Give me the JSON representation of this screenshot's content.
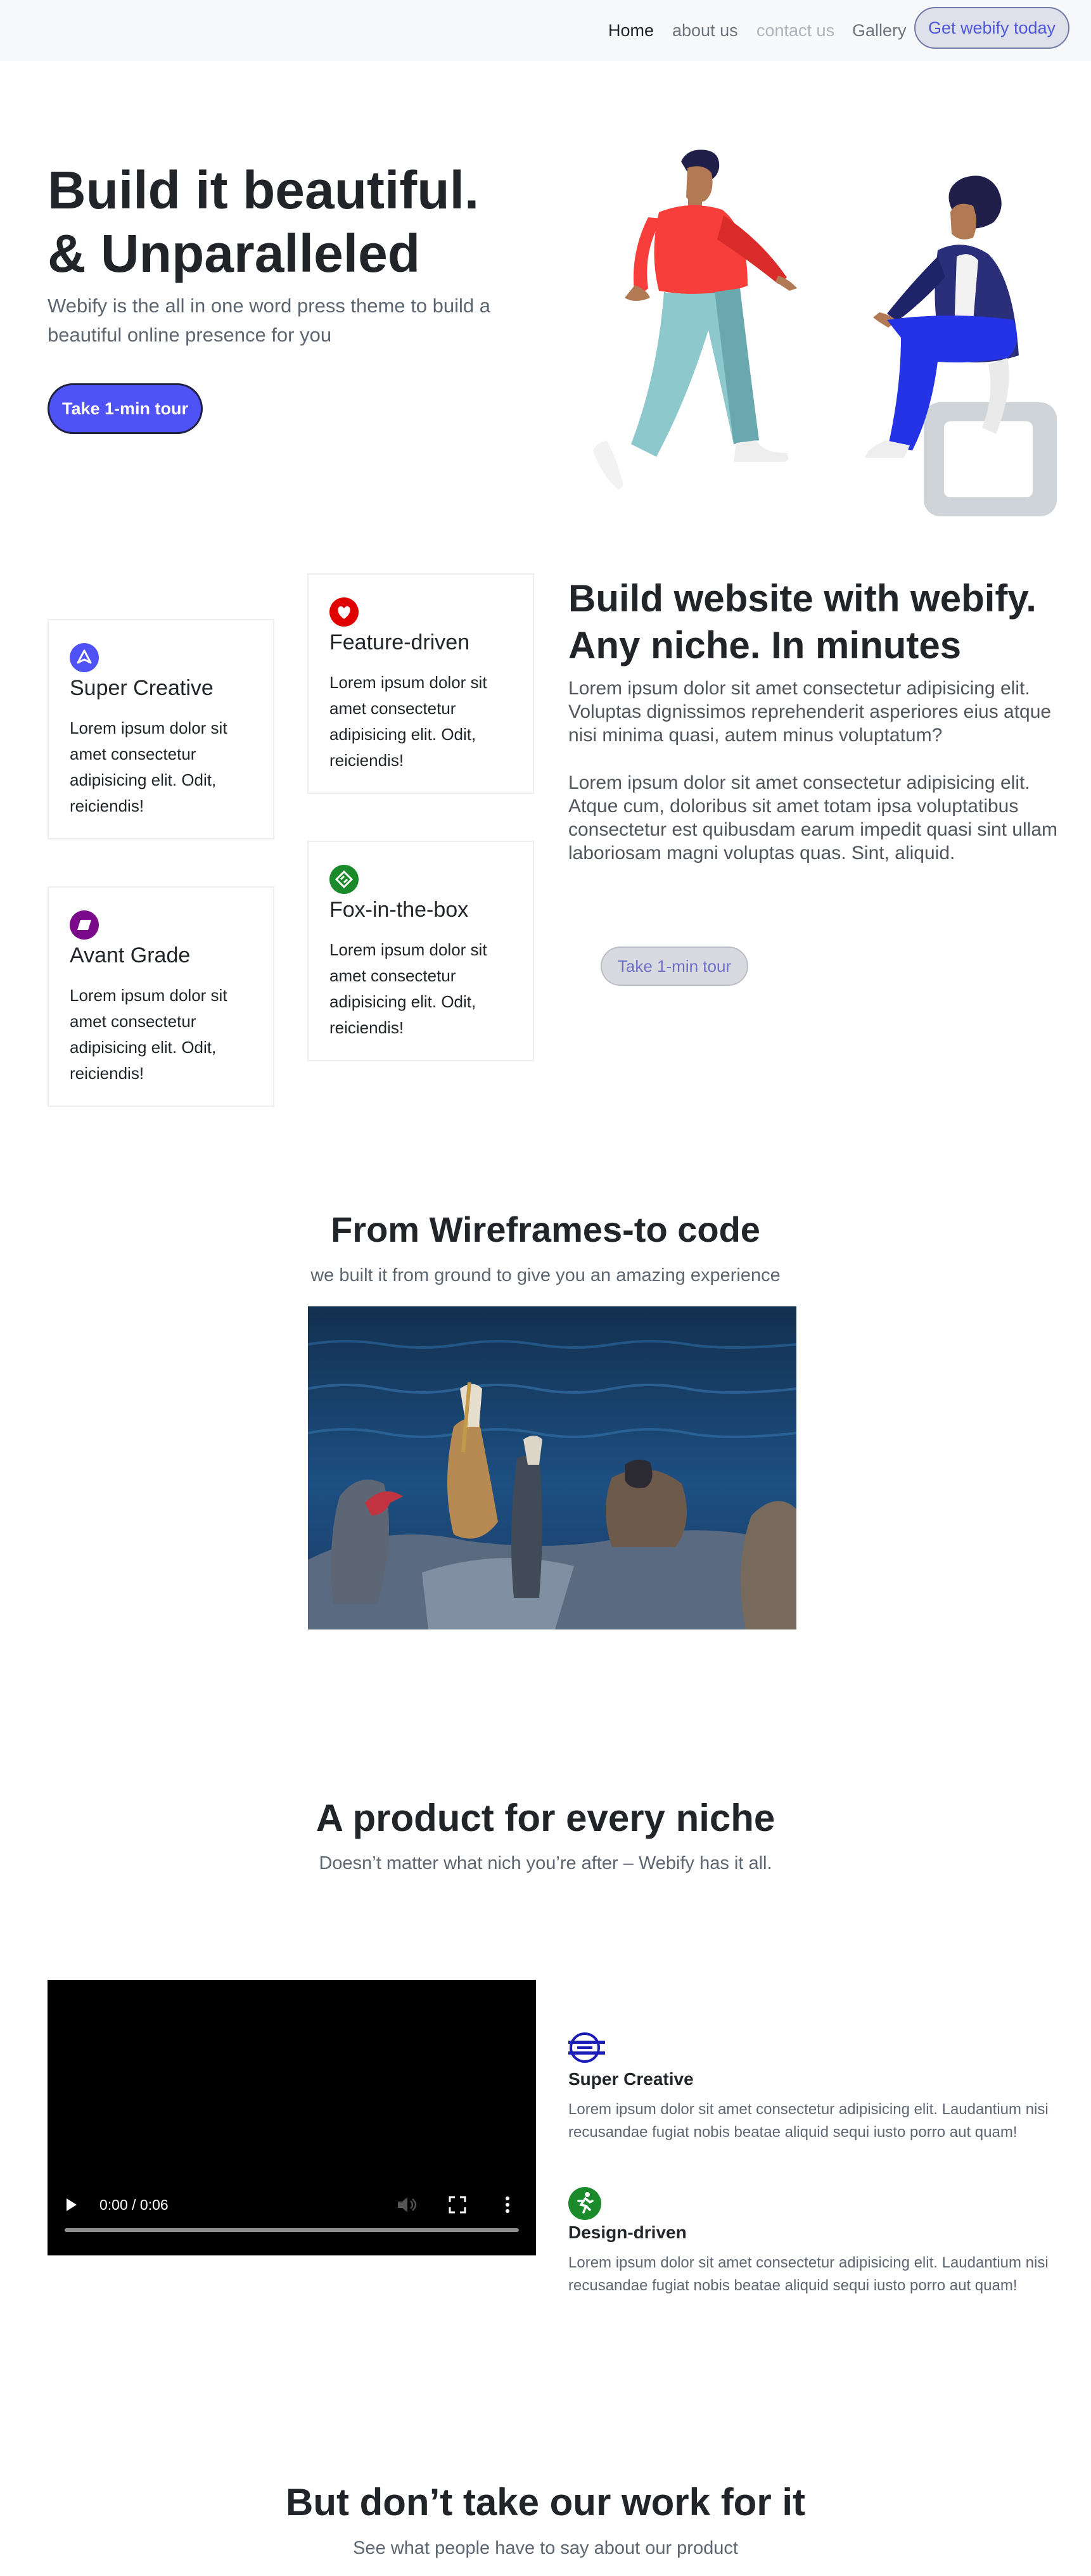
{
  "nav": {
    "items": [
      {
        "label": "Home"
      },
      {
        "label": "about us"
      },
      {
        "label": "contact us"
      },
      {
        "label": "Gallery"
      }
    ],
    "cta_label": "Get webify today"
  },
  "hero": {
    "title_line1": "Build it beautiful.",
    "title_line2": "& Unparalleled",
    "subtitle": "Webify is the all in one word press theme to build a beautiful online presence for you",
    "button_label": "Take 1-min tour"
  },
  "features": {
    "cards": [
      {
        "title": "Super Creative",
        "text": "Lorem ipsum dolor sit amet consectetur adipisicing elit. Odit, reiciendis!",
        "icon": "navigation-arrow-icon",
        "color": "#4f52f5"
      },
      {
        "title": "Feature-driven",
        "text": "Lorem ipsum dolor sit amet consectetur adipisicing elit. Odit, reiciendis!",
        "icon": "heart-icon",
        "color": "#e00000"
      },
      {
        "title": "Avant Grade",
        "text": "Lorem ipsum dolor sit amet consectetur adipisicing elit. Odit, reiciendis!",
        "icon": "parallelogram-icon",
        "color": "#7a0a8a"
      },
      {
        "title": "Fox-in-the-box",
        "text": "Lorem ipsum dolor sit amet consectetur adipisicing elit. Odit, reiciendis!",
        "icon": "diamond-link-icon",
        "color": "#1a8a2a"
      }
    ],
    "niche_title_line1": "Build website with webify.",
    "niche_title_line2": "Any niche. In minutes",
    "niche_paragraph1": "Lorem ipsum dolor sit amet consectetur adipisicing elit. Voluptas dignissimos reprehenderit asperiores eius atque nisi minima quasi, autem minus voluptatum?",
    "niche_paragraph2": "Lorem ipsum dolor sit amet consectetur adipisicing elit. Atque cum, doloribus sit amet totam ipsa voluptatibus consectetur est quibusdam earum impedit quasi sint ullam laboriosam magni voluptas quas. Sint, aliquid.",
    "niche_button_label": "Take 1-min tour"
  },
  "wireframes": {
    "title": "From Wireframes-to code",
    "subtitle": "we built it from ground to give you an amazing experience"
  },
  "product": {
    "title": "A product for every niche",
    "subtitle": "Doesn’t matter what nich you’re after – Webify has it all.",
    "video_time": "0:00 / 0:06",
    "items": [
      {
        "title": "Super Creative",
        "text": "Lorem ipsum dolor sit amet consectetur adipisicing elit. Laudantium nisi recusandae fugiat nobis beatae aliquid sequi iusto porro aut quam!",
        "icon": "subway-icon",
        "color": "#1b1bb8"
      },
      {
        "title": "Design-driven",
        "text": "Lorem ipsum dolor sit amet consectetur adipisicing elit. Laudantium nisi recusandae fugiat nobis beatae aliquid sequi iusto porro aut quam!",
        "icon": "runner-icon",
        "color": "#1a8a2a"
      }
    ]
  },
  "testimonials": {
    "title": "But don’t take our work for it",
    "subtitle": "See what people have to say about our product"
  }
}
